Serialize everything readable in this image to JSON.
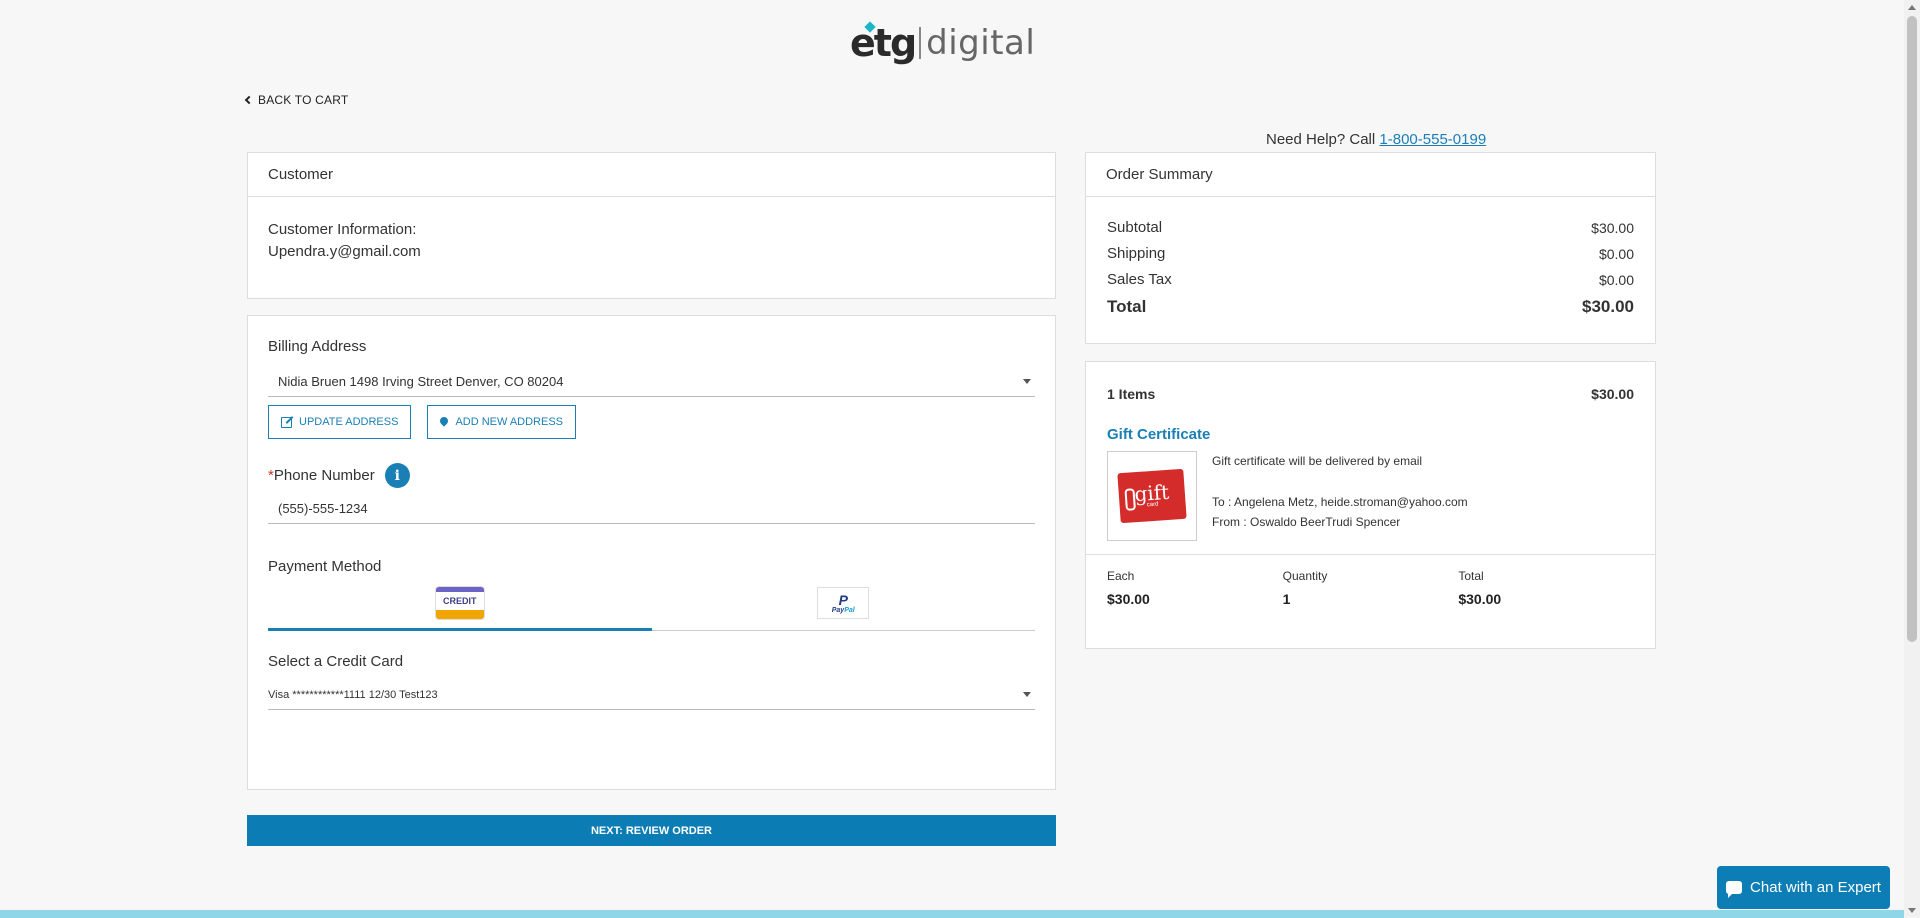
{
  "logo": {
    "part1": "etg",
    "part2": "digital"
  },
  "back_link": "BACK TO CART",
  "help": {
    "text": "Need Help? Call ",
    "phone": "1-800-555-0199"
  },
  "customer": {
    "header": "Customer",
    "info_label": "Customer Information:",
    "email": "Upendra.y@gmail.com"
  },
  "billing": {
    "label": "Billing Address",
    "selected_address": "Nidia Bruen 1498 Irving Street Denver, CO 80204",
    "update_button": "UPDATE ADDRESS",
    "add_button": "ADD NEW ADDRESS",
    "phone_required_mark": "*",
    "phone_label": "Phone Number",
    "phone_value": "(555)-555-1234",
    "payment_label": "Payment Method",
    "credit_tab": "CREDIT",
    "paypal_tab": {
      "p": "P",
      "text1": "Pay",
      "text2": "Pal"
    },
    "credit_card_label": "Select a Credit Card",
    "selected_card": "Visa ************1111 12/30 Test123"
  },
  "next_button": "NEXT: REVIEW ORDER",
  "summary": {
    "header": "Order Summary",
    "rows": [
      {
        "label": "Subtotal",
        "value": "$30.00"
      },
      {
        "label": "Shipping",
        "value": "$0.00"
      },
      {
        "label": "Sales Tax",
        "value": "$0.00"
      }
    ],
    "total_label": "Total",
    "total_value": "$30.00"
  },
  "items": {
    "count_label": "1 Items",
    "amount": "$30.00",
    "product": {
      "title": "Gift Certificate",
      "image_text": "gift",
      "image_subtext": "card",
      "delivery": "Gift certificate will be delivered by email",
      "to": "To : Angelena Metz, heide.stroman@yahoo.com",
      "from": "From : Oswaldo BeerTrudi Spencer"
    },
    "footer": {
      "each_label": "Each",
      "each_value": "$30.00",
      "qty_label": "Quantity",
      "qty_value": "1",
      "total_label": "Total",
      "total_value": "$30.00"
    }
  },
  "chat": {
    "label": "Chat with an Expert"
  },
  "colors": {
    "accent": "#0b7db4",
    "link": "#1a7fb5",
    "gift_red": "#d42b2b"
  }
}
